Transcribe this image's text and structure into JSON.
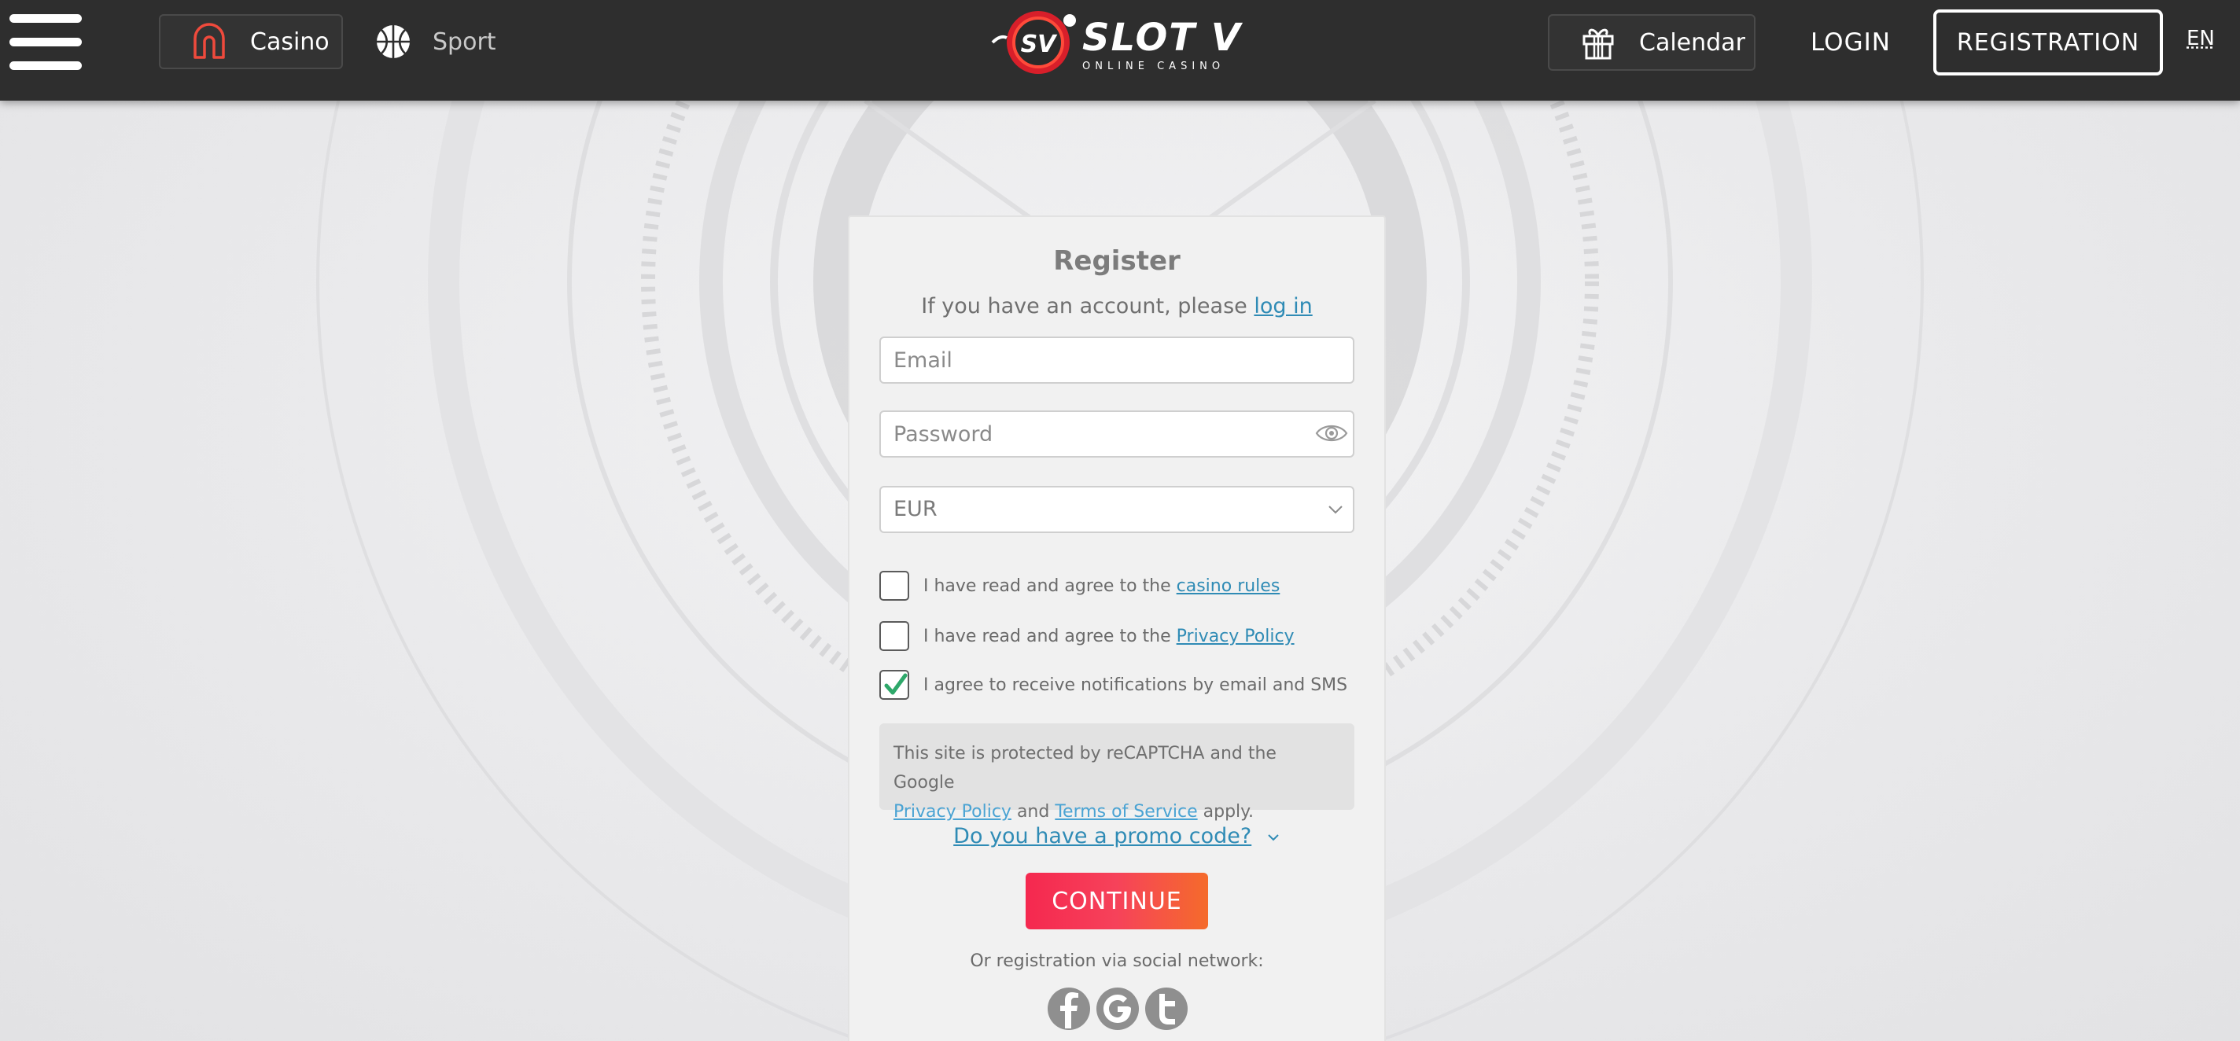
{
  "header": {
    "menu_icon": "hamburger-menu-icon",
    "nav": [
      {
        "label": "Casino",
        "icon": "casino-arch-icon",
        "active": true
      },
      {
        "label": "Sport",
        "icon": "basketball-icon",
        "active": false
      }
    ],
    "logo": {
      "badge": "SV",
      "name": "SLOT V",
      "tagline": "ONLINE CASINO"
    },
    "calendar_label": "Calendar",
    "login_label": "LOGIN",
    "registration_label": "REGISTRATION",
    "language": "EN"
  },
  "register": {
    "title": "Register",
    "subtitle_prefix": "If you have an account, please",
    "login_link": "log in",
    "email_placeholder": "Email",
    "password_placeholder": "Password",
    "currency": "EUR",
    "checkboxes": [
      {
        "text": "I have read and agree to the",
        "link": "casino rules",
        "checked": false
      },
      {
        "text": "I have read and agree to the",
        "link": "Privacy Policy",
        "checked": false
      },
      {
        "text": "I agree to receive notifications by email and SMS",
        "link": "",
        "checked": true
      }
    ],
    "recaptcha": {
      "line1": "This site is protected by reCAPTCHA and the Google",
      "privacy_link": "Privacy Policy",
      "and": "and",
      "terms_link": "Terms of Service",
      "apply": "apply."
    },
    "promo_label": "Do you have a promo code?",
    "continue_label": "CONTINUE",
    "social_text": "Or registration via social network:",
    "social_networks": [
      "facebook-icon",
      "google-icon",
      "twitter-icon"
    ]
  },
  "colors": {
    "header_bg": "#2e2e2e",
    "accent_start": "#f5284f",
    "accent_end": "#f56b2b",
    "link": "#2f8bb5",
    "check_green": "#2ea86a"
  }
}
